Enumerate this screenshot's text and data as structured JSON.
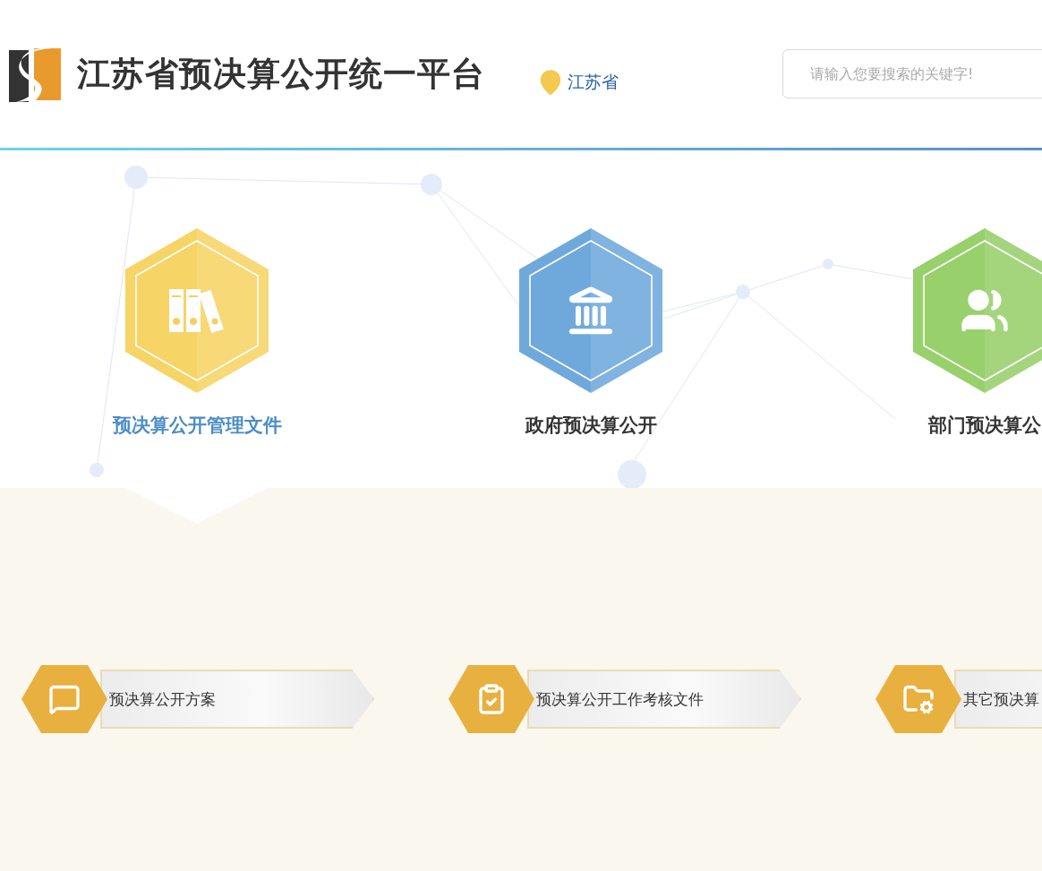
{
  "header": {
    "title": "江苏省预决算公开统一平台",
    "location": "江苏省",
    "search": {
      "placeholder": "请输入您要搜索的关键字!"
    }
  },
  "categories": [
    {
      "label": "预决算公开管理文件",
      "kind": "binders",
      "color": "#f6d466",
      "selected": true
    },
    {
      "label": "政府预决算公开",
      "kind": "government",
      "color": "#6fa9dc",
      "selected": false
    },
    {
      "label": "部门预决算公",
      "kind": "people",
      "color": "#98d06c",
      "selected": false
    }
  ],
  "sub_items": [
    {
      "label": "预决算公开方案",
      "kind": "plan"
    },
    {
      "label": "预决算公开工作考核文件",
      "kind": "assessment"
    },
    {
      "label": "其它预决算",
      "kind": "other"
    }
  ]
}
